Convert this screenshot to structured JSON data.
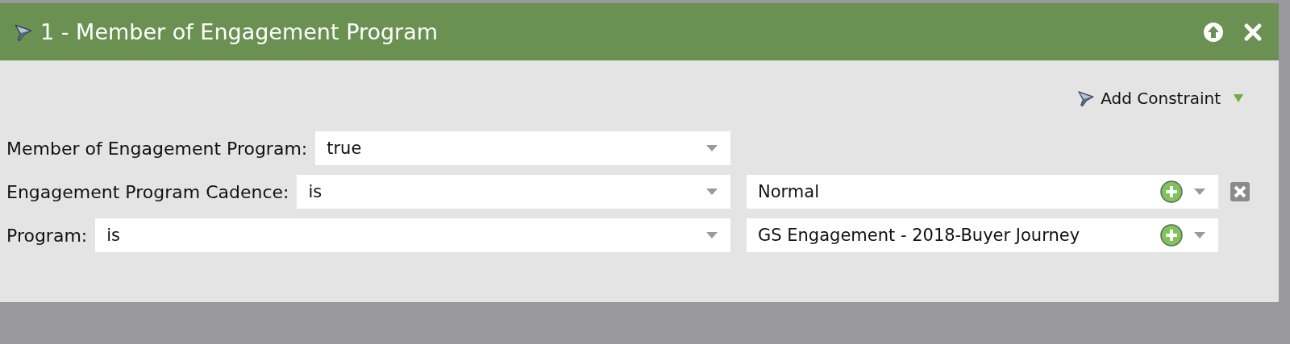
{
  "panel": {
    "title": "1 - Member of Engagement Program"
  },
  "add_constraint": {
    "label": "Add Constraint"
  },
  "rows": [
    {
      "label": "Member of Engagement Program:",
      "operator": "true"
    },
    {
      "label": "Engagement Program Cadence:",
      "operator": "is",
      "value": "Normal",
      "removable": true
    },
    {
      "label": "Program:",
      "operator": "is",
      "value": "GS Engagement - 2018-Buyer Journey",
      "removable": false
    }
  ]
}
